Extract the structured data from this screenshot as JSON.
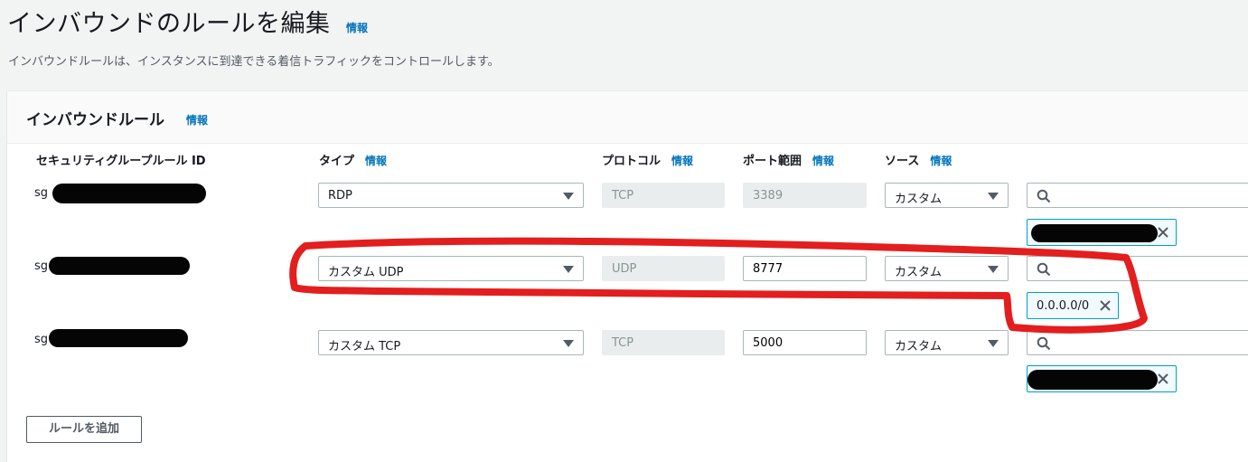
{
  "header": {
    "title": "インバウンドのルールを編集",
    "info": "情報",
    "description": "インバウンドルールは、インスタンスに到達できる着信トラフィックをコントロールします。"
  },
  "panel": {
    "title": "インバウンドルール",
    "info": "情報"
  },
  "columns": {
    "rule_id": "セキュリティグループルール ID",
    "type": "タイプ",
    "protocol": "プロトコル",
    "port_range": "ポート範囲",
    "source": "ソース",
    "info": "情報"
  },
  "rules": [
    {
      "id_prefix": "sg",
      "type": "RDP",
      "protocol": "TCP",
      "port": "3389",
      "port_editable": false,
      "source": "カスタム",
      "cidr": ""
    },
    {
      "id_prefix": "sg",
      "type": "カスタム UDP",
      "protocol": "UDP",
      "port": "8777",
      "port_editable": true,
      "source": "カスタム",
      "cidr": "0.0.0.0/0"
    },
    {
      "id_prefix": "sg",
      "type": "カスタム TCP",
      "protocol": "TCP",
      "port": "5000",
      "port_editable": true,
      "source": "カスタム",
      "cidr": ""
    }
  ],
  "add_rule_label": "ルールを追加",
  "icons": {
    "search": "search-icon",
    "remove": "close-icon",
    "dropdown": "caret-down-icon"
  },
  "colors": {
    "link": "#0073bb",
    "annotation": "#e31e1e",
    "token_border": "#00a1c9"
  }
}
